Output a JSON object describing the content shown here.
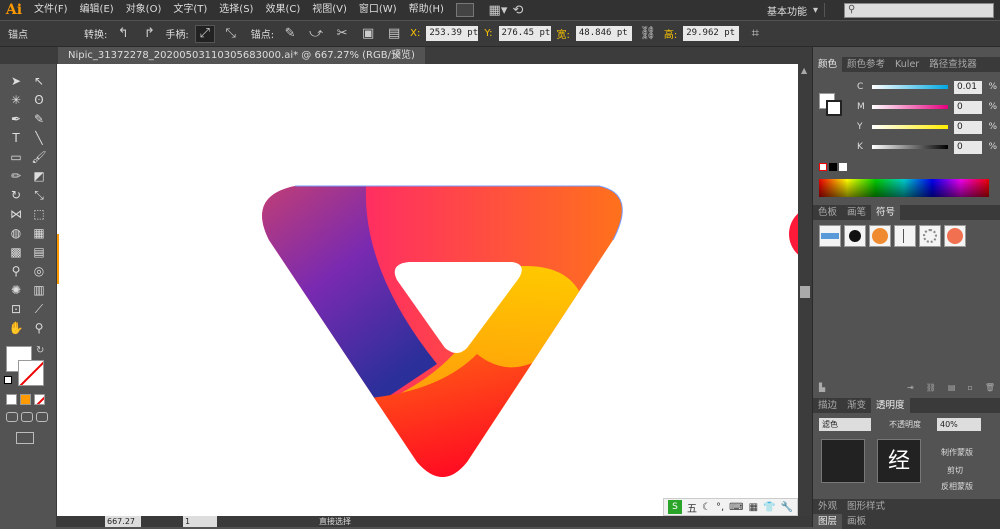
{
  "app": {
    "logo": "Ai"
  },
  "menu": [
    "文件(F)",
    "编辑(E)",
    "对象(O)",
    "文字(T)",
    "选择(S)",
    "效果(C)",
    "视图(V)",
    "窗口(W)",
    "帮助(H)"
  ],
  "workspace": "基本功能",
  "control": {
    "selection_label": "锚点",
    "convert_label": "转换:",
    "handles_label": "手柄:",
    "anchors_label": "锚点:",
    "x_label": "X:",
    "x_value": "253.39 pt",
    "y_label": "Y:",
    "y_value": "276.45 pt",
    "w_label": "宽:",
    "w_value": "48.846 pt",
    "h_label": "高:",
    "h_value": "29.962 pt"
  },
  "document": {
    "tab_title": "Nipic_31372278_20200503110305683000.ai* @ 667.27% (RGB/预览)",
    "close_glyph": "×"
  },
  "tools": [
    [
      "selection-tool",
      "➤"
    ],
    [
      "direct-selection-tool",
      "↖"
    ],
    [
      "magic-wand-tool",
      "✳"
    ],
    [
      "lasso-tool",
      "ʘ"
    ],
    [
      "pen-tool",
      "✒"
    ],
    [
      "curvature-tool",
      "✎"
    ],
    [
      "type-tool",
      "T"
    ],
    [
      "line-tool",
      "╲"
    ],
    [
      "rectangle-tool",
      "▭"
    ],
    [
      "paintbrush-tool",
      "🖌"
    ],
    [
      "pencil-tool",
      "✏"
    ],
    [
      "eraser-tool",
      "◩"
    ],
    [
      "rotate-tool",
      "↻"
    ],
    [
      "scale-tool",
      "⤡"
    ],
    [
      "width-tool",
      "⋈"
    ],
    [
      "free-transform-tool",
      "⬚"
    ],
    [
      "shape-builder-tool",
      "◍"
    ],
    [
      "perspective-tool",
      "▦"
    ],
    [
      "mesh-tool",
      "▩"
    ],
    [
      "gradient-tool",
      "▤"
    ],
    [
      "eyedropper-tool",
      "⚲"
    ],
    [
      "blend-tool",
      "◎"
    ],
    [
      "symbol-sprayer-tool",
      "✺"
    ],
    [
      "graph-tool",
      "▥"
    ],
    [
      "artboard-tool",
      "⊡"
    ],
    [
      "slice-tool",
      "⟋"
    ],
    [
      "hand-tool",
      "✋"
    ],
    [
      "zoom-tool",
      "⚲"
    ]
  ],
  "color_panel": {
    "tabs": [
      "颜色",
      "颜色参考",
      "Kuler",
      "路径查找器"
    ],
    "channels": [
      {
        "key": "C",
        "value": "0.01"
      },
      {
        "key": "M",
        "value": "0"
      },
      {
        "key": "Y",
        "value": "0"
      },
      {
        "key": "K",
        "value": "0"
      }
    ],
    "pct": "%"
  },
  "swatch_panel": {
    "tabs": [
      "色板",
      "画笔",
      "符号"
    ]
  },
  "stroke_panel": {
    "tabs": [
      "描边",
      "渐变",
      "透明度"
    ],
    "blend_mode": "滤色",
    "opacity_label": "不透明度",
    "opacity_value": "40%",
    "mask_button": "制作蒙版",
    "clip_label": "剪切",
    "invert_label": "反相蒙版",
    "thumb_text": "经"
  },
  "bottom_tabs": [
    "外观",
    "图形样式"
  ],
  "layers_tabs": [
    "图层",
    "画板"
  ],
  "status": {
    "zoom": "667.27",
    "page": "1",
    "tool_name": "直接选择"
  },
  "ime": {
    "label": "五"
  },
  "colors": {
    "accent": "#ff9a00"
  }
}
